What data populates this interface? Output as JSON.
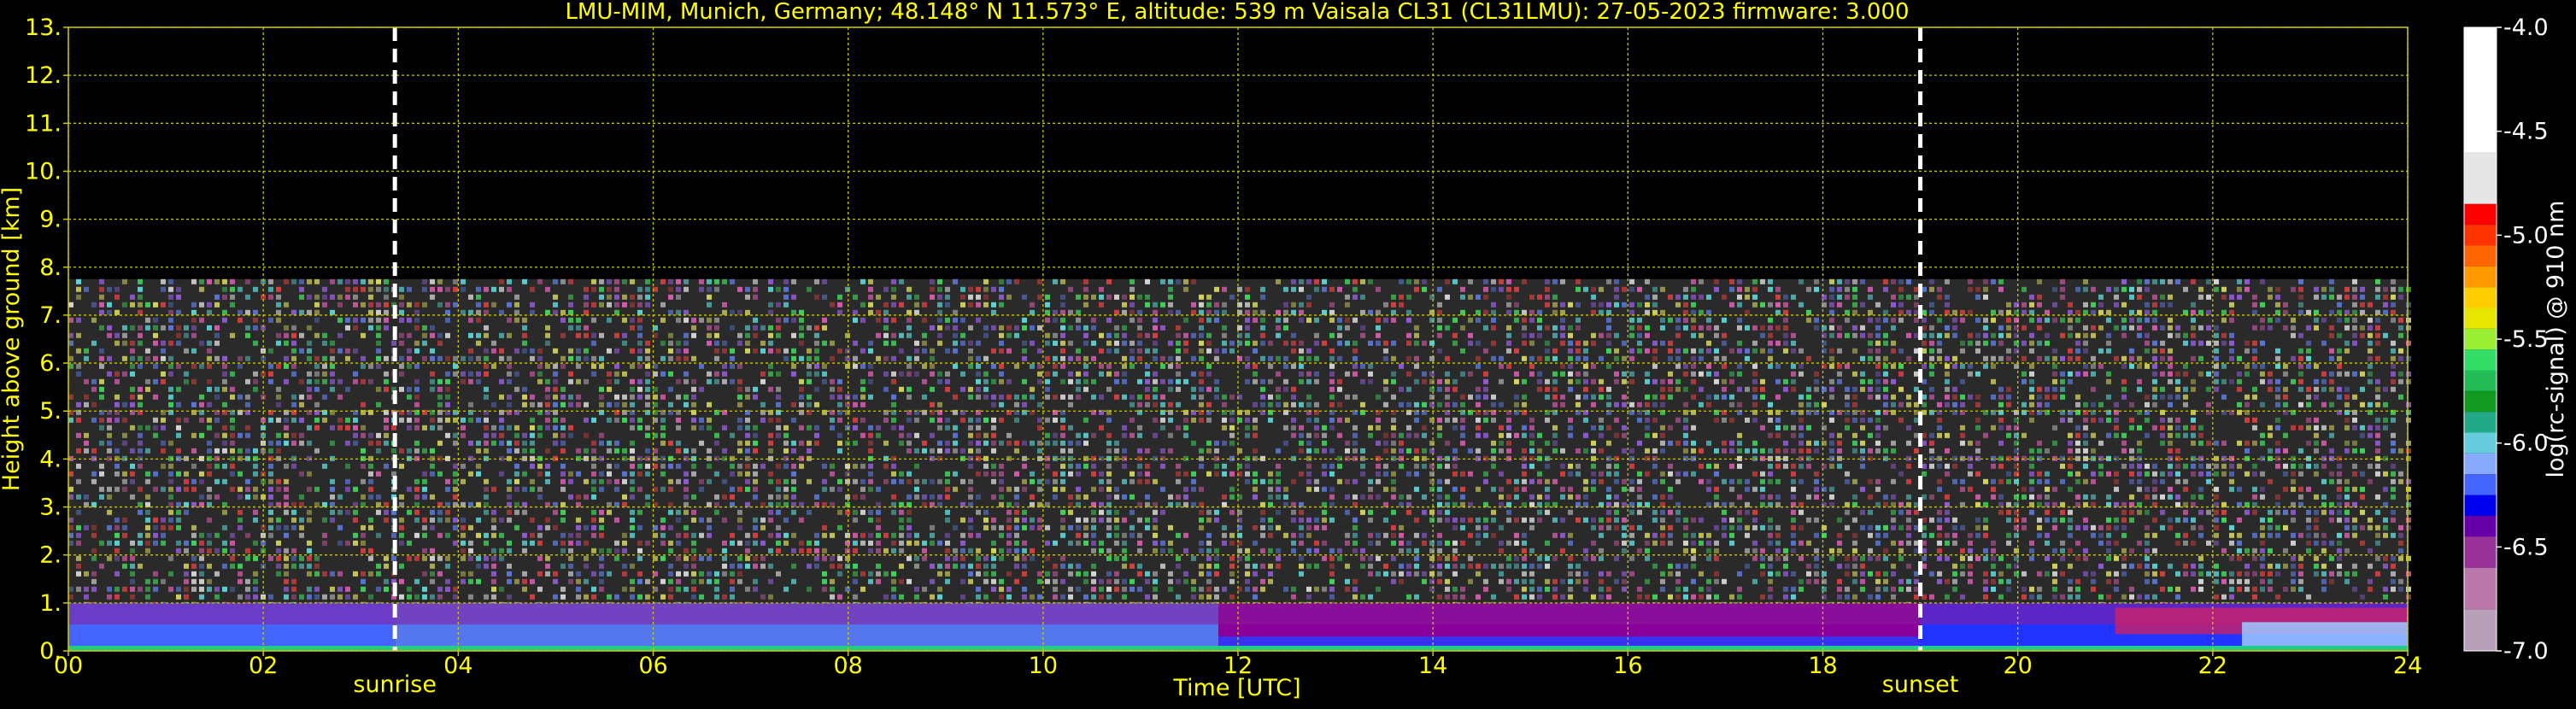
{
  "chart_data": {
    "type": "heatmap",
    "title": "LMU-MIM, Munich, Germany; 48.148° N 11.573° E, altitude: 539 m    Vaisala CL31 (CL31LMU): 27-05-2023    firmware: 3.000",
    "xlabel": "Time [UTC]",
    "ylabel": "Height above ground [km]",
    "xlim": [
      0,
      24
    ],
    "ylim": [
      0,
      13
    ],
    "x_ticks": [
      0,
      2,
      4,
      6,
      8,
      10,
      12,
      14,
      16,
      18,
      20,
      22,
      24
    ],
    "x_tick_labels": [
      "00",
      "02",
      "04",
      "06",
      "08",
      "10",
      "12",
      "14",
      "16",
      "18",
      "20",
      "22",
      "24"
    ],
    "y_ticks": [
      0,
      1,
      2,
      3,
      4,
      5,
      6,
      7,
      8,
      9,
      10,
      11,
      12,
      13
    ],
    "y_tick_labels": [
      "0.",
      "1.",
      "2.",
      "3.",
      "4.",
      "5.",
      "6.",
      "7.",
      "8.",
      "9.",
      "10.",
      "11.",
      "12.",
      "13."
    ],
    "grid": true,
    "annotations": [
      {
        "label": "sunrise",
        "x": 3.35
      },
      {
        "label": "sunset",
        "x": 19.0
      }
    ],
    "signal_top_km": 7.75,
    "colorbar": {
      "label": "log(rc-signal) @ 910 nm",
      "range": [
        -7.0,
        -4.0
      ],
      "ticks": [
        -4.0,
        -4.5,
        -5.0,
        -5.5,
        -6.0,
        -6.5,
        -7.0
      ],
      "tick_labels": [
        "-4.0",
        "-4.5",
        "-5.0",
        "-5.5",
        "-6.0",
        "-6.5",
        "-7.0"
      ],
      "colors": [
        {
          "from": -4.0,
          "to": -4.6,
          "color": "#ffffff"
        },
        {
          "from": -4.6,
          "to": -4.85,
          "color": "#e6e6e6"
        },
        {
          "from": -4.85,
          "to": -4.95,
          "color": "#ff0000"
        },
        {
          "from": -4.95,
          "to": -5.05,
          "color": "#ff3300"
        },
        {
          "from": -5.05,
          "to": -5.15,
          "color": "#ff6600"
        },
        {
          "from": -5.15,
          "to": -5.25,
          "color": "#ff9900"
        },
        {
          "from": -5.25,
          "to": -5.35,
          "color": "#ffcc00"
        },
        {
          "from": -5.35,
          "to": -5.45,
          "color": "#e6e600"
        },
        {
          "from": -5.45,
          "to": -5.55,
          "color": "#99ee33"
        },
        {
          "from": -5.55,
          "to": -5.65,
          "color": "#33dd66"
        },
        {
          "from": -5.65,
          "to": -5.75,
          "color": "#22bb55"
        },
        {
          "from": -5.75,
          "to": -5.85,
          "color": "#119922"
        },
        {
          "from": -5.85,
          "to": -5.95,
          "color": "#22aa88"
        },
        {
          "from": -5.95,
          "to": -6.05,
          "color": "#66ccdd"
        },
        {
          "from": -6.05,
          "to": -6.15,
          "color": "#88aaff"
        },
        {
          "from": -6.15,
          "to": -6.25,
          "color": "#4466ff"
        },
        {
          "from": -6.25,
          "to": -6.35,
          "color": "#0000ee"
        },
        {
          "from": -6.35,
          "to": -6.45,
          "color": "#6600aa"
        },
        {
          "from": -6.45,
          "to": -6.6,
          "color": "#993399"
        },
        {
          "from": -6.6,
          "to": -6.8,
          "color": "#bb77aa"
        },
        {
          "from": -6.8,
          "to": -7.0,
          "color": "#b8a0b8"
        }
      ]
    },
    "boundary_layer_colors": {
      "night_early": "#4466ff",
      "day": "#880099",
      "evening": "#2233ff",
      "noise": [
        "#ff4444",
        "#44ff66",
        "#6688ff",
        "#ffffff",
        "#ff66cc",
        "#66ffff",
        "#ffff66",
        "#aa66ff"
      ]
    }
  },
  "colors": {
    "background": "#000000",
    "text": "#ffff00",
    "grid": "#c8c800",
    "colorbar_text": "#ffffff",
    "marker": "#ffffff"
  }
}
